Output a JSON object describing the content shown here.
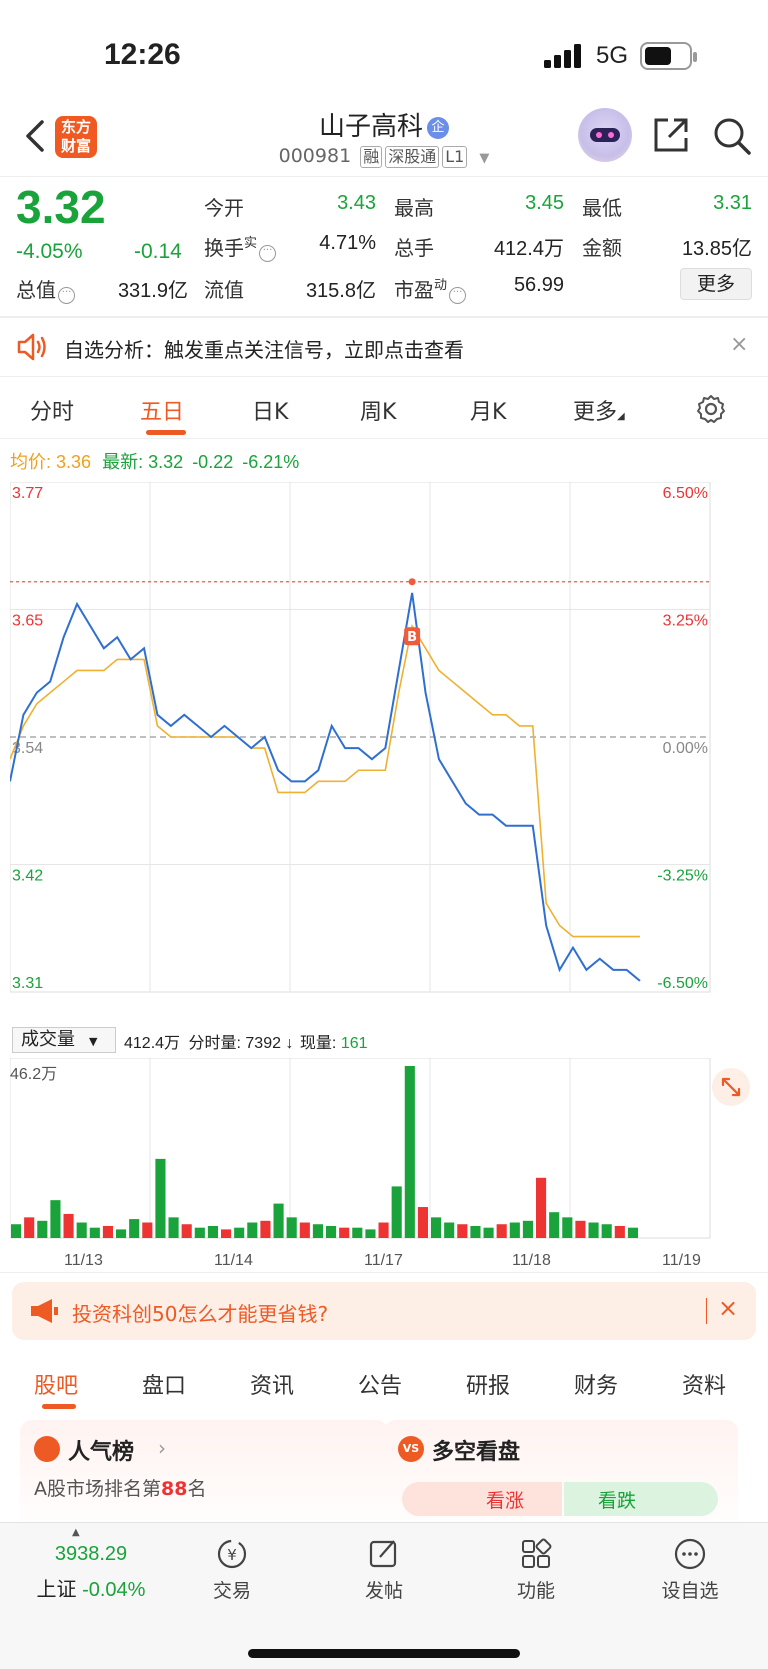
{
  "status": {
    "time": "12:26",
    "network": "5G"
  },
  "header": {
    "title": "山子高科",
    "badge": "企",
    "code": "000981",
    "tags": [
      "融",
      "深股通",
      "L1"
    ],
    "logo_text_1": "东方",
    "logo_text_2": "财富"
  },
  "quote": {
    "price": "3.32",
    "change_pct": "-4.05%",
    "change": "-0.14",
    "stats": [
      {
        "label": "今开",
        "value": "3.43",
        "color": "#1aa33a"
      },
      {
        "label": "最高",
        "value": "3.45",
        "color": "#1aa33a"
      },
      {
        "label": "最低",
        "value": "3.31",
        "color": "#1aa33a"
      },
      {
        "label": "换手",
        "value": "4.71%",
        "color": "#222"
      },
      {
        "label": "总手",
        "value": "412.4万",
        "color": "#222"
      },
      {
        "label": "金额",
        "value": "13.85亿",
        "color": "#222"
      },
      {
        "label": "总值",
        "value": "331.9亿",
        "color": "#222"
      },
      {
        "label": "流值",
        "value": "315.8亿",
        "color": "#222"
      },
      {
        "label": "市盈",
        "value": "56.99",
        "color": "#222"
      }
    ],
    "turnover_sup": "实",
    "pe_sup": "动",
    "more": "更多"
  },
  "alert": {
    "text": "自选分析：触发重点关注信号，立即点击查看",
    "close": "×"
  },
  "chart_tabs": [
    "分时",
    "五日",
    "日K",
    "周K",
    "月K",
    "更多"
  ],
  "legend": {
    "avg_label": "均价:",
    "avg_value": "3.36",
    "latest_label": "最新:",
    "latest_value": "3.32",
    "latest_change": "-0.22",
    "latest_pct": "-6.21%"
  },
  "chart_data": {
    "type": "line",
    "title": "",
    "x_days": [
      "11/13",
      "11/14",
      "11/17",
      "11/18",
      "11/19"
    ],
    "y_ticks_left": [
      "3.77",
      "3.65",
      "3.54",
      "3.42",
      "3.31"
    ],
    "y_ticks_right": [
      "6.50%",
      "3.25%",
      "0.00%",
      "-3.25%",
      "-6.50%"
    ],
    "ylim": [
      3.31,
      3.77
    ],
    "prev_close": 3.54,
    "marker_high": 3.68,
    "marker_label": "B",
    "series": [
      {
        "values": [
          3.5,
          3.56,
          3.58,
          3.59,
          3.63,
          3.66,
          3.64,
          3.62,
          3.63,
          3.61,
          3.62,
          3.56,
          3.55,
          3.56,
          3.55,
          3.54,
          3.55,
          3.54,
          3.53,
          3.54,
          3.51,
          3.5,
          3.5,
          3.51,
          3.55,
          3.53,
          3.53,
          3.52,
          3.53,
          3.6,
          3.67,
          3.58,
          3.52,
          3.5,
          3.48,
          3.47,
          3.47,
          3.46,
          3.46,
          3.46,
          3.37,
          3.33,
          3.35,
          3.33,
          3.34,
          3.33,
          3.33,
          3.32
        ]
      },
      {
        "values": [
          3.52,
          3.55,
          3.57,
          3.58,
          3.59,
          3.6,
          3.6,
          3.6,
          3.61,
          3.61,
          3.61,
          3.55,
          3.54,
          3.54,
          3.54,
          3.54,
          3.54,
          3.54,
          3.53,
          3.53,
          3.49,
          3.49,
          3.49,
          3.5,
          3.5,
          3.5,
          3.51,
          3.51,
          3.51,
          3.58,
          3.64,
          3.62,
          3.6,
          3.59,
          3.58,
          3.57,
          3.56,
          3.56,
          3.55,
          3.55,
          3.39,
          3.37,
          3.36,
          3.36,
          3.36,
          3.36,
          3.36,
          3.36
        ]
      }
    ]
  },
  "volume": {
    "select_label": "成交量",
    "total": "412.4万",
    "split_label": "分时量:",
    "split_value": "7392",
    "now_label": "现量:",
    "now_value": "161",
    "max_label": "46.2万",
    "bars": [
      8,
      12,
      10,
      22,
      14,
      9,
      6,
      7,
      5,
      11,
      9,
      46,
      12,
      8,
      6,
      7,
      5,
      6,
      9,
      10,
      20,
      12,
      9,
      8,
      7,
      6,
      6,
      5,
      9,
      30,
      100,
      18,
      12,
      9,
      8,
      7,
      6,
      8,
      9,
      10,
      35,
      15,
      12,
      10,
      9,
      8,
      7,
      6
    ]
  },
  "dates": [
    "11/13",
    "11/14",
    "11/17",
    "11/18",
    "11/19"
  ],
  "promo": {
    "text": "投资科创50怎么才能更省钱?",
    "close": "×"
  },
  "bottom_tabs": [
    "股吧",
    "盘口",
    "资讯",
    "公告",
    "研报",
    "财务",
    "资料"
  ],
  "cards": {
    "left_title": "人气榜",
    "left_sub_prefix": "A股市场排名第",
    "left_rank": "88",
    "left_sub_suffix": "名",
    "right_title": "多空看盘",
    "up": "看涨",
    "down": "看跌"
  },
  "tab_bar": {
    "index_value": "3938.29",
    "index_name": "上证",
    "index_pct": "-0.04%",
    "items": [
      "交易",
      "发帖",
      "功能",
      "设自选"
    ]
  }
}
